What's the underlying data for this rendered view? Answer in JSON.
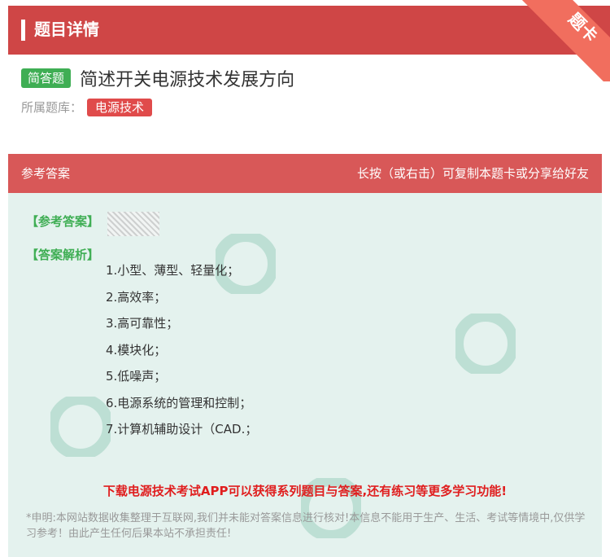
{
  "header": {
    "title": "题目详情",
    "ribbon": "题卡"
  },
  "question": {
    "type_badge": "简答题",
    "title": "简述开关电源技术发展方向",
    "library_label": "所属题库：",
    "library_name": "电源技术"
  },
  "answer_section": {
    "left_label": "参考答案",
    "right_label": "长按（或右击）可复制本题卡或分享给好友",
    "ref_tag": "【参考答案】",
    "analysis_tag": "【答案解析】",
    "items": [
      "1.小型、薄型、轻量化；",
      "2.高效率；",
      "3.高可靠性；",
      "4.模块化；",
      "5.低噪声；",
      "6.电源系统的管理和控制；",
      "7.计算机辅助设计（CAD.；"
    ],
    "promo": "下载电源技术考试APP可以获得系列题目与答案,还有练习等更多学习功能!",
    "disclaimer": "*申明:本网站数据收集整理于互联网,我们并未能对答案信息进行核对!本信息不能用于生产、生活、考试等情境中,仅供学习参考！由此产生任何后果本站不承担责任!"
  },
  "colors": {
    "header": "#cf4646",
    "badge_green": "#3fae54",
    "badge_red": "#e04b4b",
    "answer_bg": "#e4f2ee"
  }
}
